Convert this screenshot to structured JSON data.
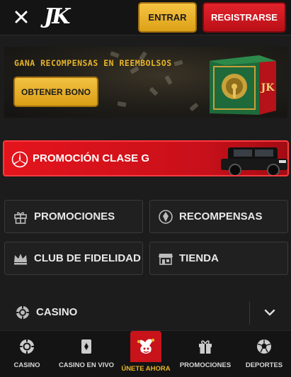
{
  "header": {
    "logo": "JK",
    "login_label": "ENTRAR",
    "register_label": "REGISTRARSE"
  },
  "banner": {
    "title": "GANA RECOMPENSAS EN REEMBOLSOS",
    "button_label": "OBTENER BONO",
    "safe_label": "JK"
  },
  "promo_bar": {
    "label": "PROMOCIÓN CLASE G",
    "icon": "mercedes-star-icon"
  },
  "tiles": [
    {
      "label": "PROMOCIONES",
      "icon": "gift-icon"
    },
    {
      "label": "RECOMPENSAS",
      "icon": "diamond-icon"
    },
    {
      "label": "CLUB DE FIDELIDAD",
      "icon": "crown-icon"
    },
    {
      "label": "TIENDA",
      "icon": "store-icon"
    }
  ],
  "casino_row": {
    "label": "CASINO",
    "icon": "chip-icon"
  },
  "bottom_nav": [
    {
      "label": "CASINO",
      "icon": "chip-icon"
    },
    {
      "label": "CASINO EN VIVO",
      "icon": "cards-icon"
    },
    {
      "label": "ÚNETE AHORA",
      "icon": "jester-icon"
    },
    {
      "label": "PROMOCIONES",
      "icon": "gift-icon"
    },
    {
      "label": "DEPORTES",
      "icon": "soccer-ball-icon"
    }
  ],
  "colors": {
    "background": "#1c1c1c",
    "gold": "#e7b52a",
    "red": "#d8141c"
  }
}
